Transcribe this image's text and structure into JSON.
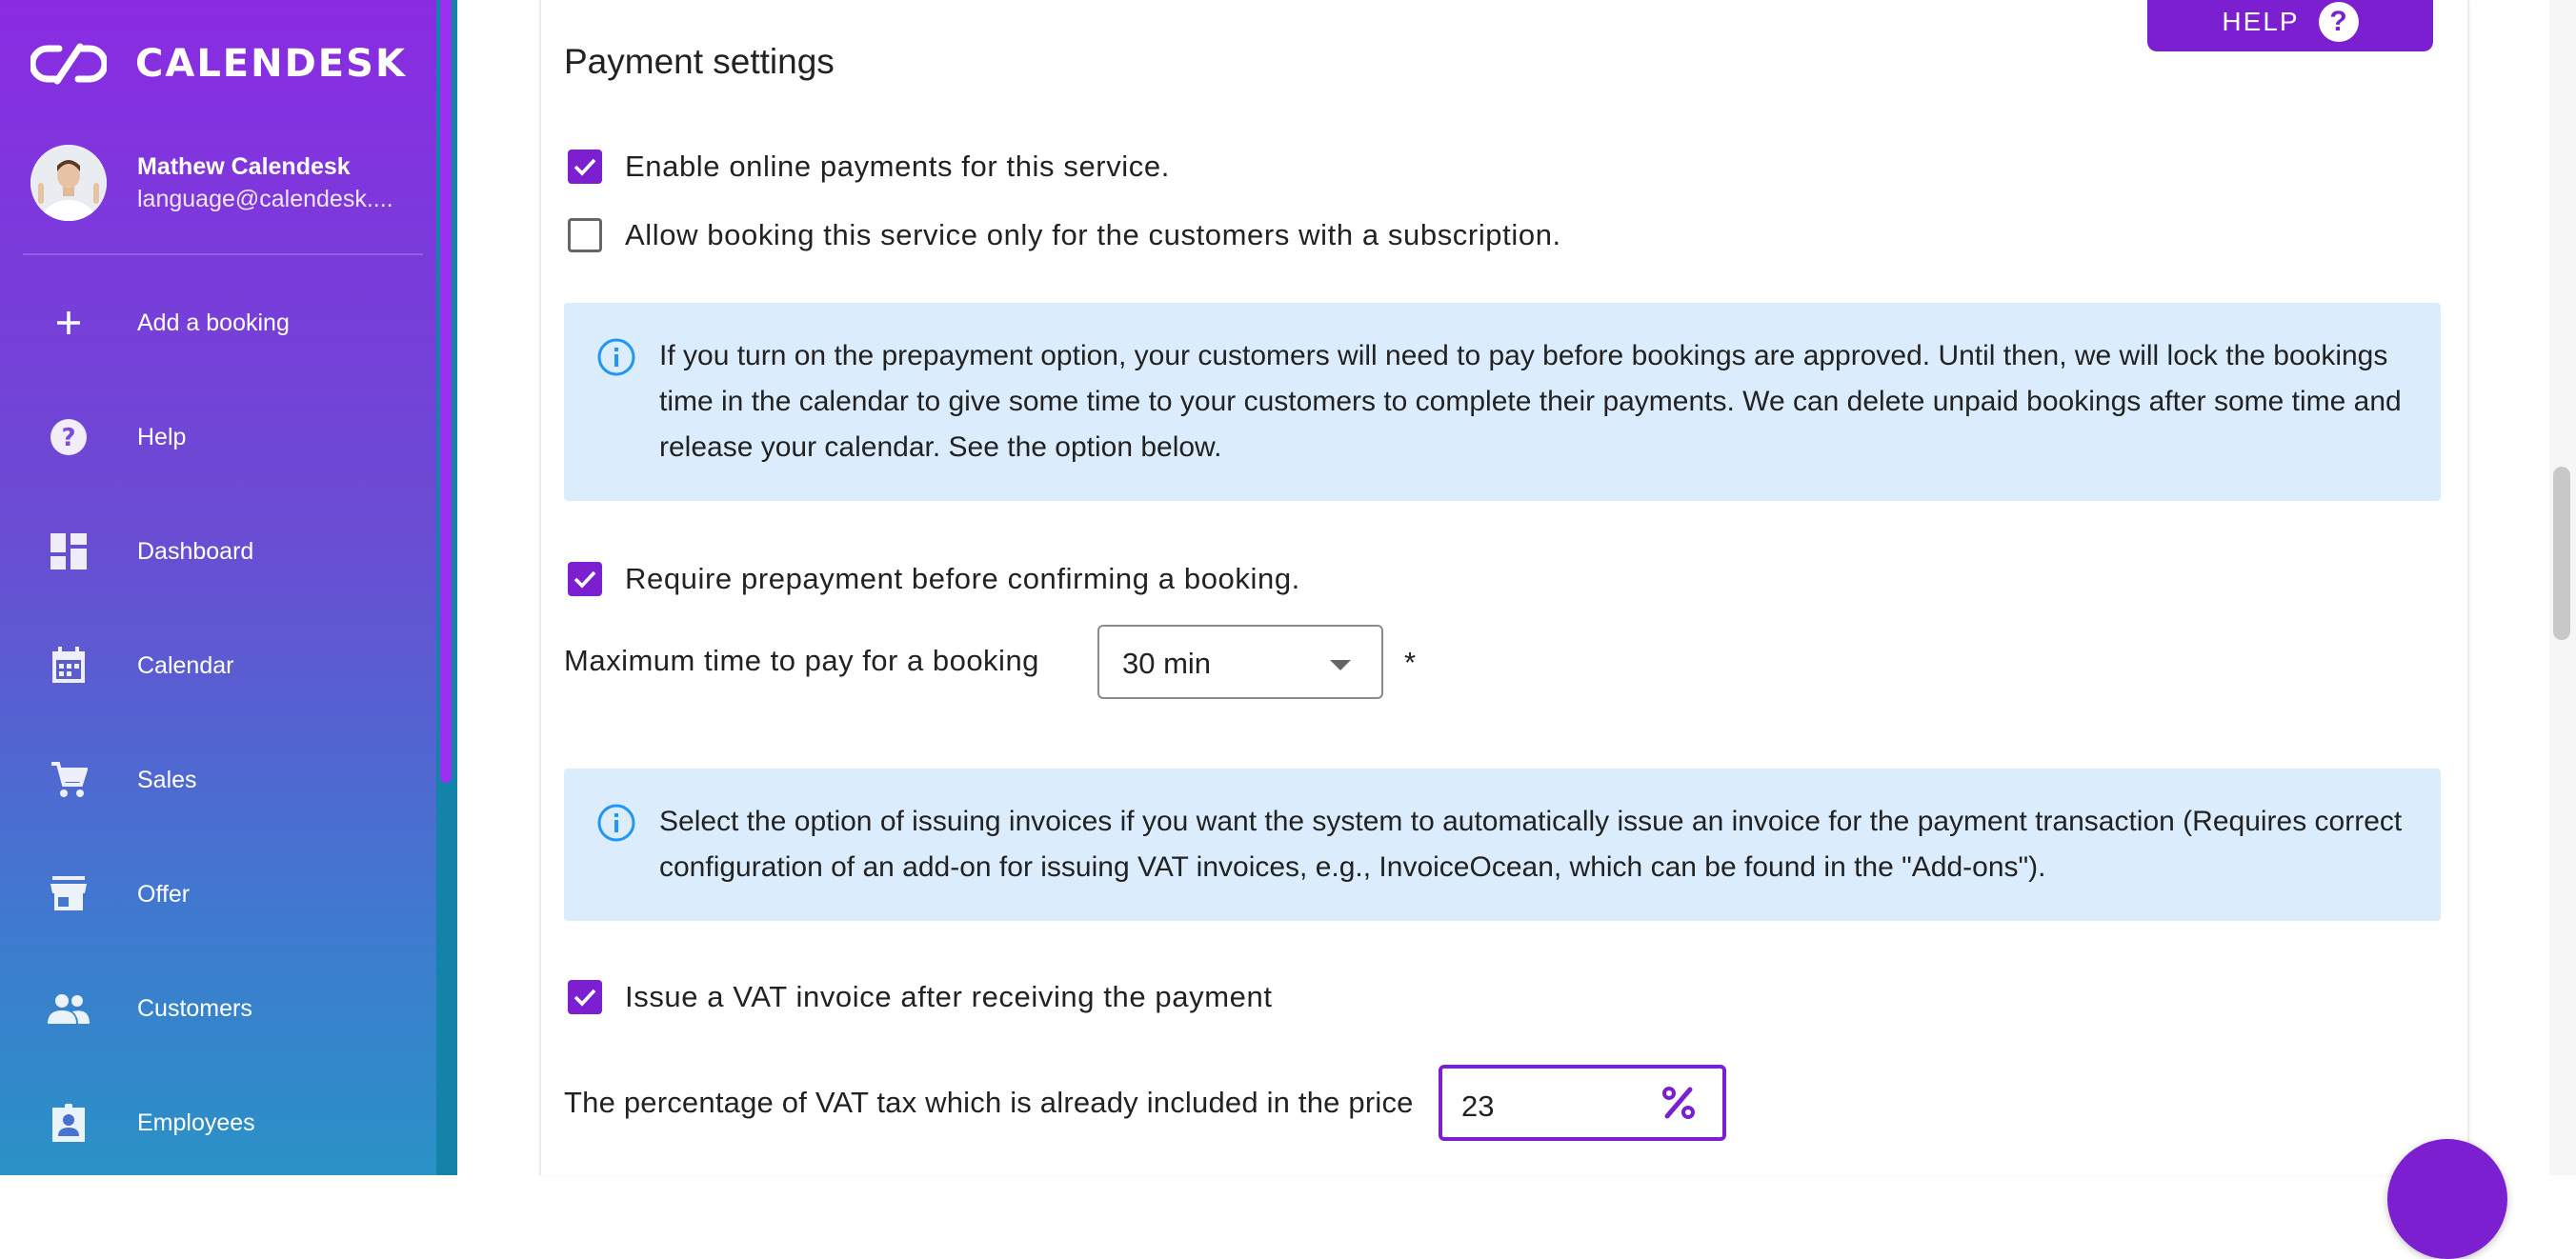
{
  "app": {
    "brand_name": "CALENDESK",
    "accent_color": "#7b1fd0",
    "info_box_color": "#dbecfc"
  },
  "sidebar": {
    "user": {
      "name": "Mathew Calendesk",
      "email": "language@calendesk...."
    },
    "items": [
      {
        "label": "Add a booking",
        "icon": "plus-icon"
      },
      {
        "label": "Help",
        "icon": "help-circle-icon"
      },
      {
        "label": "Dashboard",
        "icon": "dashboard-icon"
      },
      {
        "label": "Calendar",
        "icon": "calendar-icon"
      },
      {
        "label": "Sales",
        "icon": "shopping-cart-icon"
      },
      {
        "label": "Offer",
        "icon": "store-icon"
      },
      {
        "label": "Customers",
        "icon": "people-icon"
      },
      {
        "label": "Employees",
        "icon": "employee-badge-icon"
      }
    ]
  },
  "header": {
    "help_label": "HELP",
    "help_icon": "?"
  },
  "payment_settings": {
    "title": "Payment settings",
    "enable_online_payments": {
      "label": "Enable online payments for this service.",
      "checked": true
    },
    "subscription_only": {
      "label": "Allow booking this service only for the customers with a subscription.",
      "checked": false
    },
    "prepayment_info": "If you turn on the prepayment option, your customers will need to pay before bookings are approved. Until then, we will lock the bookings time in the calendar to give some time to your customers to complete their payments. We can delete unpaid bookings after some time and release your calendar. See the option below.",
    "require_prepayment": {
      "label": "Require prepayment before confirming a booking.",
      "checked": true
    },
    "max_time_to_pay": {
      "label": "Maximum time to pay for a booking",
      "value": "30 min",
      "required_mark": "*"
    },
    "invoice_info": "Select the option of issuing invoices if you want the system to automatically issue an invoice for the payment transaction (Requires correct configuration of an add-on for issuing VAT invoices, e.g., InvoiceOcean, which can be found in the \"Add-ons\").",
    "issue_vat_invoice": {
      "label": "Issue a VAT invoice after receiving the payment",
      "checked": true
    },
    "vat_percentage": {
      "label": "The percentage of VAT tax which is already included in the price",
      "value": "23",
      "icon": "percent-icon"
    }
  }
}
